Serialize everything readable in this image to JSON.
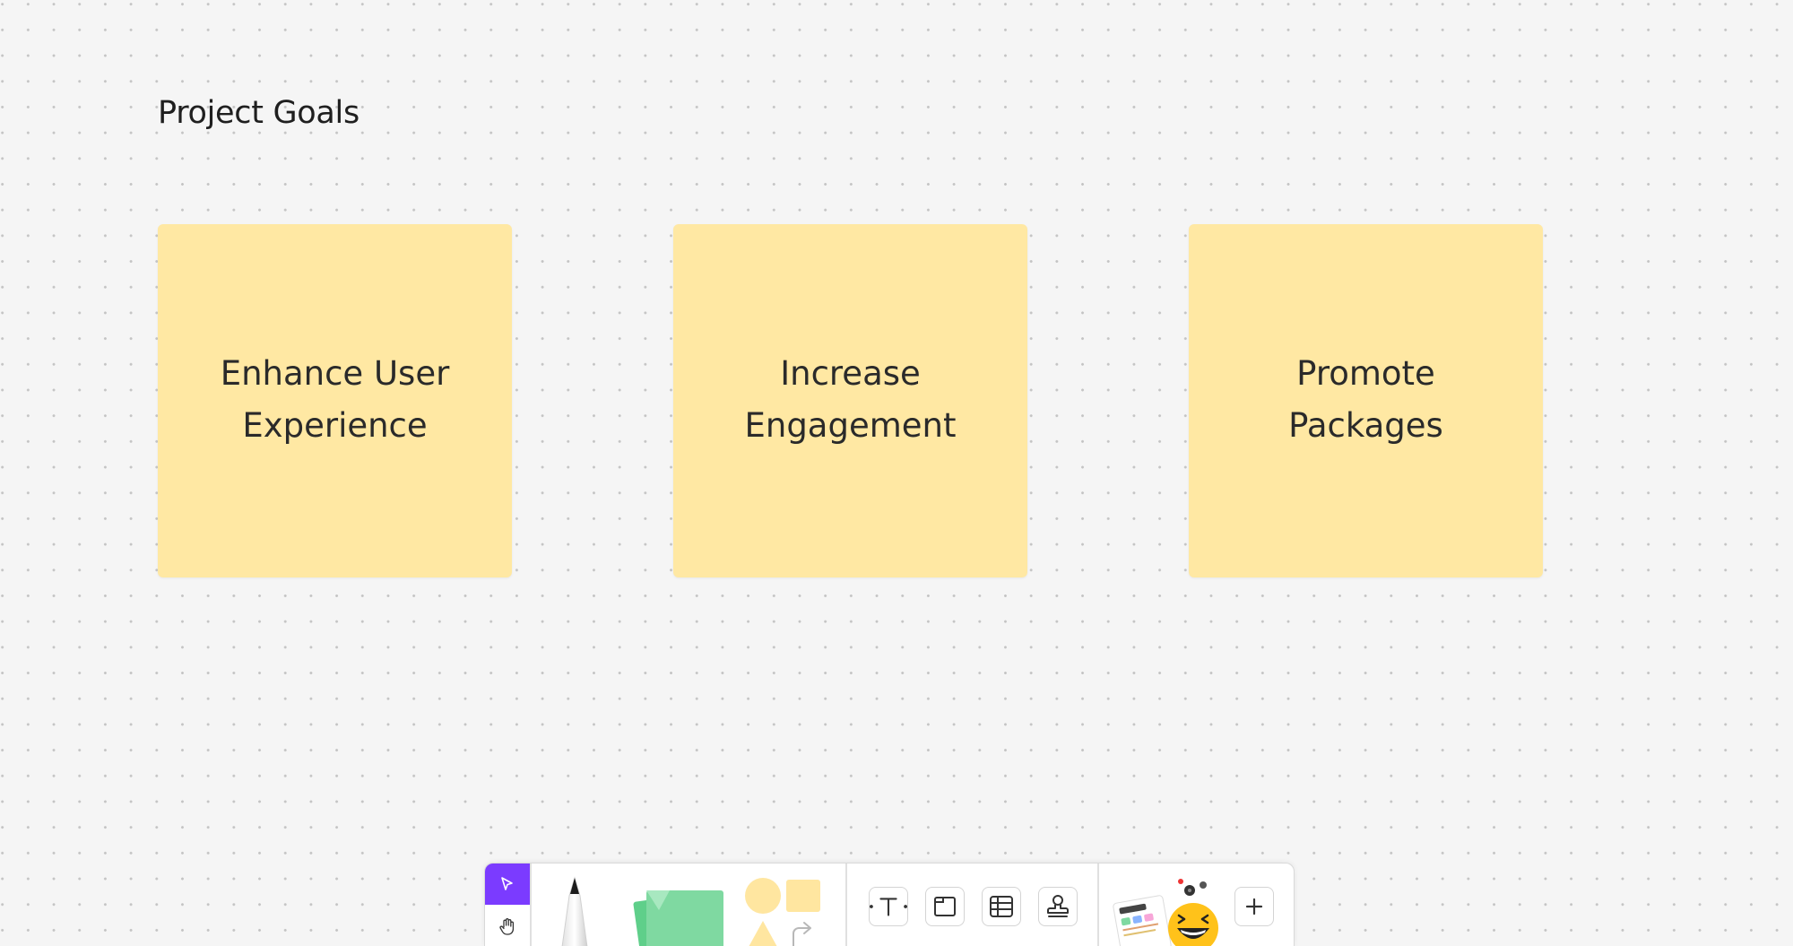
{
  "board": {
    "title": "Project Goals",
    "sticky_color": "#ffe8a3"
  },
  "stickies": [
    {
      "text": "Enhance User Experience"
    },
    {
      "text": "Increase Engagement"
    },
    {
      "text": "Promote Packages"
    }
  ],
  "toolbar": {
    "accent_color": "#7b3bff",
    "tools": [
      {
        "name": "select",
        "icon": "cursor-arrow-icon"
      },
      {
        "name": "hand",
        "icon": "hand-icon"
      },
      {
        "name": "pen",
        "icon": "pen-icon"
      },
      {
        "name": "sticky-notes",
        "icon": "sticky-note-icon"
      },
      {
        "name": "shapes",
        "icon": "shapes-icon"
      },
      {
        "name": "text",
        "icon": "text-icon"
      },
      {
        "name": "section",
        "icon": "section-icon"
      },
      {
        "name": "table",
        "icon": "table-icon"
      },
      {
        "name": "stamp",
        "icon": "stamp-icon"
      },
      {
        "name": "widgets",
        "icon": "widgets-icon"
      },
      {
        "name": "more",
        "icon": "plus-icon"
      }
    ]
  }
}
